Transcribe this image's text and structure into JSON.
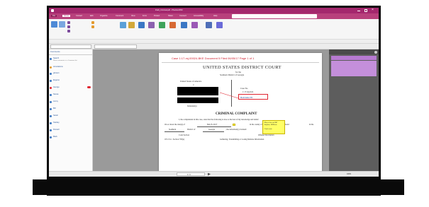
{
  "window": {
    "title": "Draft_Criminal.pdf - PhantomPDF"
  },
  "ribbon": {
    "tabs": [
      "File",
      "Home",
      "Convert",
      "Edit",
      "Organize",
      "Comment",
      "View",
      "Form",
      "Protect",
      "Share",
      "Connect",
      "Accessibility",
      "Help"
    ]
  },
  "sidebar": {
    "header": "Comments",
    "items": [
      {
        "label": "Search",
        "sub": "Show comments in a Comment list"
      },
      {
        "label": "Annotations",
        "sub": ""
      },
      {
        "label": "gbrown",
        "sub": ""
      },
      {
        "label": "Eugene",
        "sub": ""
      },
      {
        "label": "George",
        "sub": ""
      },
      {
        "label": "Nessa",
        "sub": ""
      },
      {
        "label": "Jenny",
        "sub": ""
      },
      {
        "label": "Bill",
        "sub": ""
      },
      {
        "label": "Sarah",
        "sub": ""
      },
      {
        "label": "Stanley",
        "sub": ""
      },
      {
        "label": "Russell",
        "sub": ""
      },
      {
        "label": "Mark",
        "sub": ""
      }
    ]
  },
  "document": {
    "case_header": "Case 1:17-mj-00024-BKE   Document 5   Filed 06/05/17   Page 1 of 1",
    "court_title": "UNITED STATES DISTRICT COURT",
    "for_the": "for the",
    "district": "Southern District of Georgia",
    "plaintiff": "United States of America",
    "versus": "v.",
    "case_no_label": "Case No.",
    "case_no": "1:17-mj-024",
    "defendant_label": "Defendant(s)",
    "highlight_box_text": "Reinstate PA",
    "complaint_title": "CRIMINAL COMPLAINT",
    "complaint_line1": "I, the complainant in this case, state that the following is true to the best of my knowledge and belief.",
    "complaint_line2_a": "On or about the date(s) of",
    "complaint_date": "May 8, 2017",
    "complaint_line2_b": "in the county of",
    "complaint_county": "Richmond",
    "complaint_line2_c": "in the",
    "complaint_line3_a": "Southern",
    "complaint_line3_b": "District of",
    "complaint_line3_c": "Georgia",
    "complaint_line3_d": ", the defendant(s) violated:",
    "code_section_label": "Code Section",
    "offense_label": "Offense Description",
    "code_section": "18 U.S.C. Section 793(e)",
    "offense": "Gathering, Transmitting or Losing Defense Information",
    "sticky_note_lines": [
      "Why is this not PA?",
      "Stephen, R/Wilson"
    ],
    "sticky_note_footer": "Check note"
  },
  "status": {
    "page_indicator": "1 / 1",
    "zoom": "100%"
  },
  "colors": {
    "accent": "#a4276d",
    "ribbon_tab_bg": "#b8407c",
    "highlight_red": "#e0242f",
    "sticky_yellow": "#ffff66",
    "note_purple": "#b77ad1"
  }
}
